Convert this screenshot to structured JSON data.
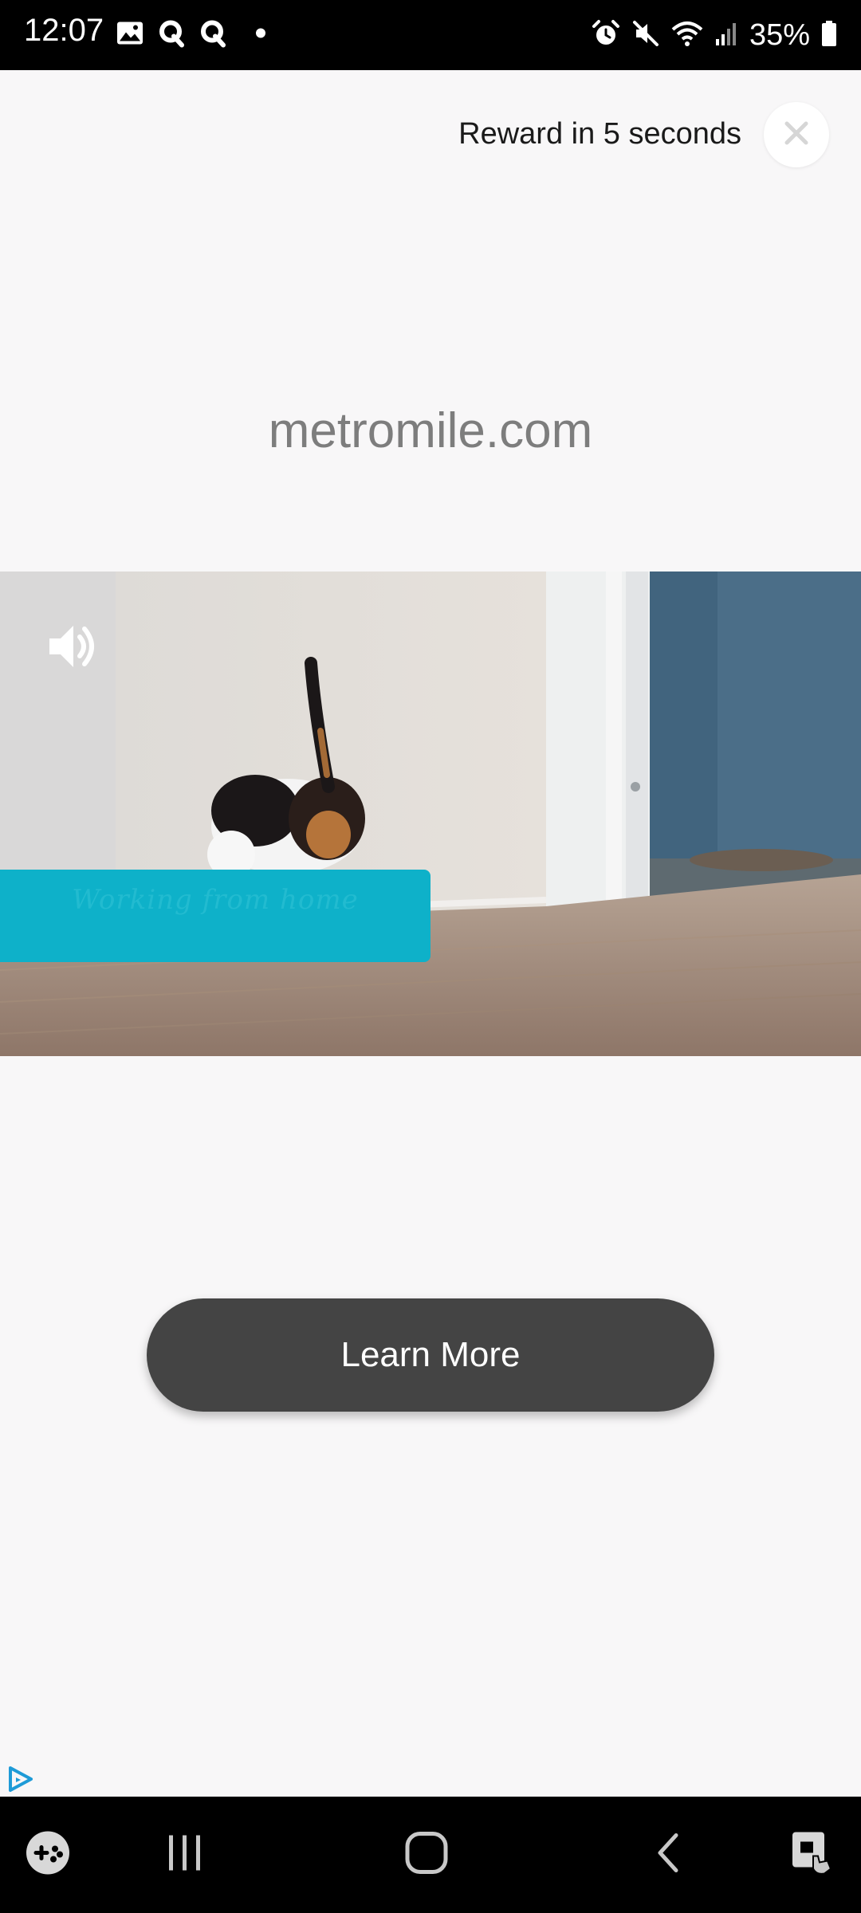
{
  "status_bar": {
    "time": "12:07",
    "battery_percent": "35%",
    "left_icons": [
      "image-icon",
      "q-app-icon",
      "q-app-icon",
      "dot-icon"
    ],
    "right_icons": [
      "alarm-icon",
      "mute-icon",
      "wifi-icon",
      "signal-icon",
      "battery-icon"
    ]
  },
  "ad": {
    "reward_text": "Reward in 5 seconds",
    "close_icon": "close-icon",
    "advertiser_domain": "metromile.com",
    "video": {
      "caption_text": "Working from home",
      "sound_icon": "volume-icon"
    },
    "cta_label": "Learn More",
    "adchoices_icon": "adchoices-icon"
  },
  "nav_bar": {
    "items": [
      "game-launcher-icon",
      "recent-apps-icon",
      "home-icon",
      "back-icon",
      "accessibility-icon"
    ]
  },
  "colors": {
    "background": "#f8f7f8",
    "cta": "#444444",
    "caption_box": "#0eb1c9",
    "adchoices": "#1e9bd7"
  }
}
